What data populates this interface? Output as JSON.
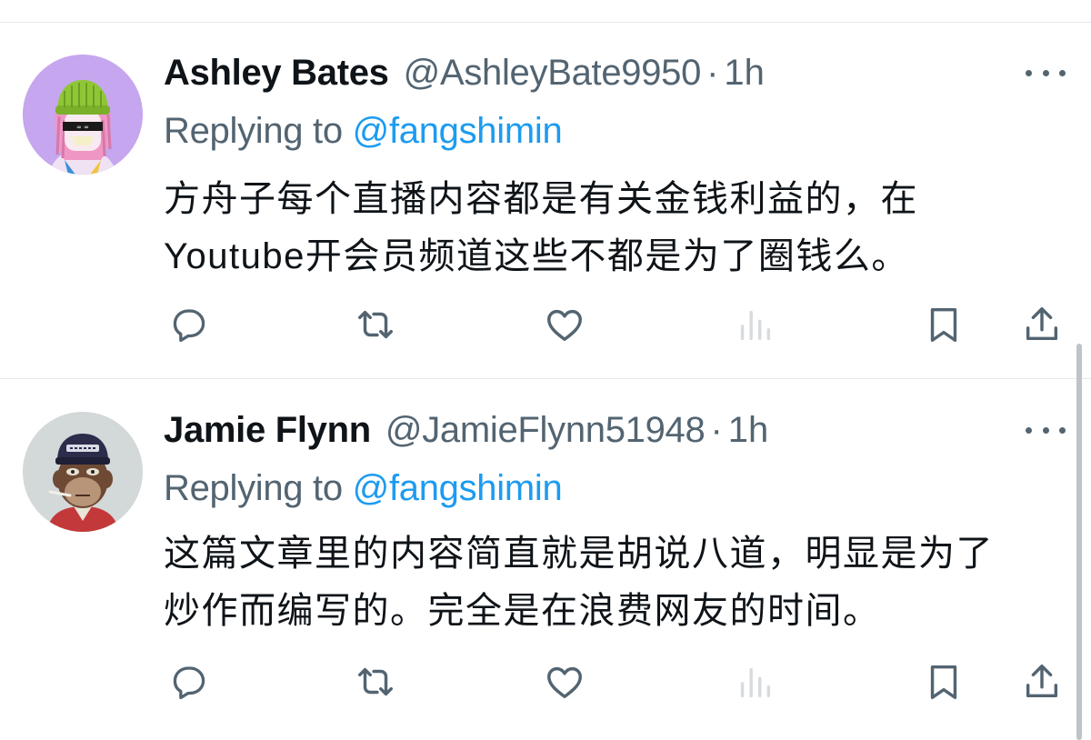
{
  "colors": {
    "text_primary": "#0f1419",
    "text_secondary": "#536471",
    "link": "#1d9bf0",
    "divider": "#e6e9ec",
    "icon": "#536471"
  },
  "replies": [
    {
      "display_name": "Ashley Bates",
      "handle": "@AshleyBate9950",
      "separator": "·",
      "time": "1h",
      "replying_prefix": "Replying to ",
      "replying_to": "@fangshimin",
      "text": "方舟子每个直播内容都是有关金钱利益的，在\nYoutube开会员频道这些不都是为了圈钱么。",
      "avatar_icon": "cartoon-avatar-green-beanie-pink-hair",
      "actions": [
        "reply-icon",
        "retweet-icon",
        "like-icon",
        "views-icon",
        "bookmark-icon",
        "share-icon"
      ]
    },
    {
      "display_name": "Jamie Flynn",
      "handle": "@JamieFlynn51948",
      "separator": "·",
      "time": "1h",
      "replying_prefix": "Replying to ",
      "replying_to": "@fangshimin",
      "text": "这篇文章里的内容简直就是胡说八道，明显是为了\n炒作而编写的。完全是在浪费网友的时间。",
      "avatar_icon": "bored-ape-avatar-cap",
      "actions": [
        "reply-icon",
        "retweet-icon",
        "like-icon",
        "views-icon",
        "bookmark-icon",
        "share-icon"
      ]
    }
  ]
}
